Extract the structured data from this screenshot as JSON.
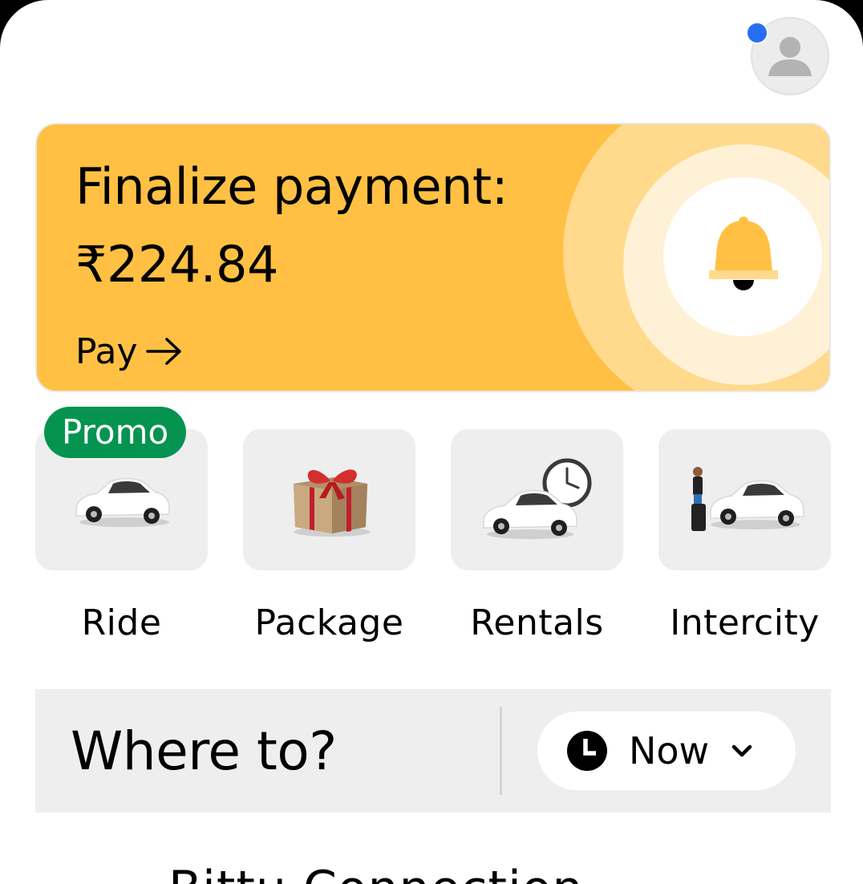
{
  "profile": {
    "icon": "person-icon",
    "notification_dot_color": "#276ef1"
  },
  "banner": {
    "title": "Finalize payment:",
    "amount": "₹224.84",
    "action_label": "Pay",
    "action_icon": "arrow-right-icon",
    "icon": "bell-icon",
    "background_color": "#ffc043"
  },
  "services": [
    {
      "label": "Ride",
      "icon": "car-icon",
      "badge": "Promo"
    },
    {
      "label": "Package",
      "icon": "gift-box-icon"
    },
    {
      "label": "Rentals",
      "icon": "car-clock-icon"
    },
    {
      "label": "Intercity",
      "icon": "traveler-car-icon"
    }
  ],
  "promo_badge_color": "#05944f",
  "search": {
    "placeholder": "Where to?",
    "time_selector": {
      "label": "Now",
      "icon": "clock-icon",
      "dropdown_icon": "chevron-down-icon"
    }
  },
  "recent": {
    "partial_label": "Bittu Connection"
  }
}
